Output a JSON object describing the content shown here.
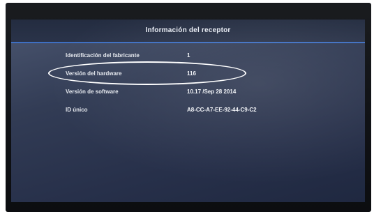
{
  "screen": {
    "title": "Información del receptor"
  },
  "info_rows": [
    {
      "label": "Identificación del fabricante",
      "value": "1"
    },
    {
      "label": "Versión del hardware",
      "value": "116"
    },
    {
      "label": "Versión de software",
      "value": "10.17 /Sep 28 2014"
    },
    {
      "label": "ID único",
      "value": "A8-CC-A7-EE-92-44-C9-C2"
    }
  ],
  "colors": {
    "header_accent": "#3e6fc2",
    "screen_background": "#323c55",
    "annotation": "#ffffff"
  }
}
